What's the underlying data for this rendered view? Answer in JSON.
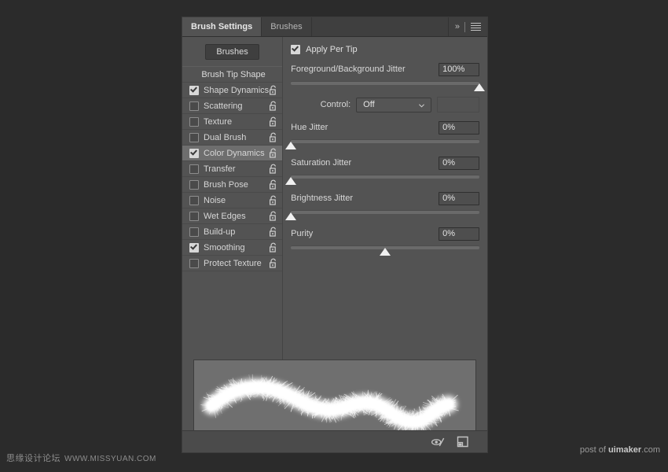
{
  "panel": {
    "tabs": [
      {
        "label": "Brush Settings",
        "active": true
      },
      {
        "label": "Brushes",
        "active": false
      }
    ],
    "collapse_label": "»",
    "menu_icon": "hamburger-menu-icon",
    "brushes_button": "Brushes"
  },
  "sidebar": {
    "header": "Brush Tip Shape",
    "items": [
      {
        "label": "Shape Dynamics",
        "checked": true,
        "selected": false,
        "locked": false
      },
      {
        "label": "Scattering",
        "checked": false,
        "selected": false,
        "locked": false
      },
      {
        "label": "Texture",
        "checked": false,
        "selected": false,
        "locked": false
      },
      {
        "label": "Dual Brush",
        "checked": false,
        "selected": false,
        "locked": false
      },
      {
        "label": "Color Dynamics",
        "checked": true,
        "selected": true,
        "locked": false
      },
      {
        "label": "Transfer",
        "checked": false,
        "selected": false,
        "locked": false
      },
      {
        "label": "Brush Pose",
        "checked": false,
        "selected": false,
        "locked": false
      },
      {
        "label": "Noise",
        "checked": false,
        "selected": false,
        "locked": false
      },
      {
        "label": "Wet Edges",
        "checked": false,
        "selected": false,
        "locked": false
      },
      {
        "label": "Build-up",
        "checked": false,
        "selected": false,
        "locked": false
      },
      {
        "label": "Smoothing",
        "checked": true,
        "selected": false,
        "locked": false
      },
      {
        "label": "Protect Texture",
        "checked": false,
        "selected": false,
        "locked": false
      }
    ]
  },
  "settings": {
    "apply_per_tip": {
      "label": "Apply Per Tip",
      "checked": true
    },
    "fg_bg_jitter": {
      "label": "Foreground/Background Jitter",
      "value": "100%",
      "percent": 100
    },
    "control": {
      "label": "Control:",
      "value": "Off",
      "extra_value": ""
    },
    "hue_jitter": {
      "label": "Hue Jitter",
      "value": "0%",
      "percent": 0
    },
    "saturation_jitter": {
      "label": "Saturation Jitter",
      "value": "0%",
      "percent": 0
    },
    "brightness_jitter": {
      "label": "Brightness Jitter",
      "value": "0%",
      "percent": 0
    },
    "purity": {
      "label": "Purity",
      "value": "0%",
      "percent": 50
    }
  },
  "bottom_toolbar": {
    "toggle_preview_icon": "brush-stroke-preview-icon",
    "new_brush_icon": "new-brush-icon"
  },
  "watermarks": {
    "left_cn": "思缘设计论坛",
    "left_url": "WWW.MISSYUAN.COM",
    "right_prefix": "post of ",
    "right_brand": "uimaker",
    "right_suffix": ".com"
  },
  "colors": {
    "page_bg": "#2b2b2b",
    "panel_bg": "#535353",
    "tabbar_bg": "#3f3f3f",
    "row_selected": "#6e6e6e",
    "preview_bg": "#6f6f6f",
    "stroke": "#ffffff"
  }
}
